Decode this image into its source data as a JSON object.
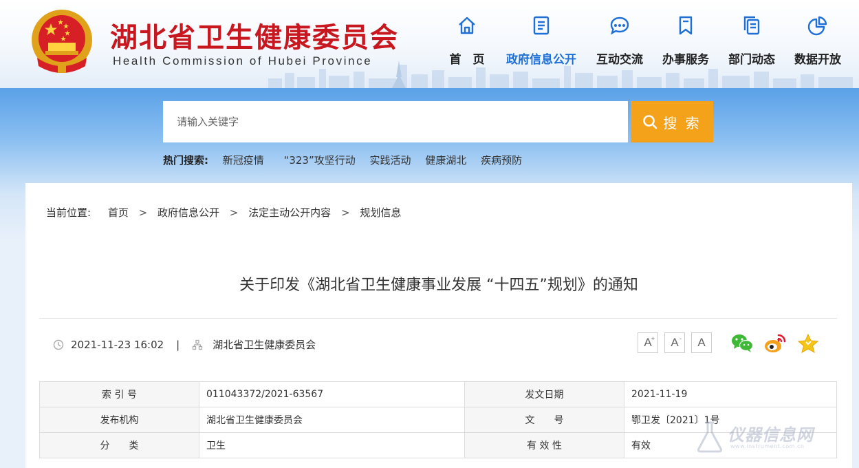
{
  "header": {
    "title": "湖北省卫生健康委员会",
    "subtitle": "Health Commission of Hubei Province",
    "nav": [
      {
        "label": "首　页",
        "icon": "home-icon"
      },
      {
        "label": "政府信息公开",
        "icon": "document-list-icon",
        "active": true
      },
      {
        "label": "互动交流",
        "icon": "chat-bubble-icon"
      },
      {
        "label": "办事服务",
        "icon": "bookmark-icon"
      },
      {
        "label": "部门动态",
        "icon": "copy-document-icon"
      },
      {
        "label": "数据开放",
        "icon": "pie-chart-icon"
      }
    ]
  },
  "search": {
    "placeholder": "请输入关键字",
    "button_label": "搜 索",
    "hot_label": "热门搜索:",
    "hot_terms": [
      "新冠疫情",
      "“323”攻坚行动",
      "实践活动",
      "健康湖北",
      "疾病预防"
    ]
  },
  "breadcrumb": {
    "label": "当前位置:",
    "items": [
      "首页",
      "政府信息公开",
      "法定主动公开内容",
      "规划信息"
    ],
    "separator": ">"
  },
  "article": {
    "title": "关于印发《湖北省卫生健康事业发展 “十四五”规划》的通知",
    "datetime": "2021-11-23 16:02",
    "separator": "|",
    "publisher": "湖北省卫生健康委员会",
    "font_sizes": [
      "A",
      "A",
      "A"
    ],
    "share_icons": [
      "wechat-icon",
      "weibo-icon",
      "favorite-star-icon"
    ]
  },
  "info_table": [
    {
      "k1": "索 引 号",
      "v1": "011043372/2021-63567",
      "k2": "发文日期",
      "v2": "2021-11-19"
    },
    {
      "k1": "发布机构",
      "v1": "湖北省卫生健康委员会",
      "k2": "文　　号",
      "v2": "鄂卫发〔2021〕1号"
    },
    {
      "k1": "分　　类",
      "v1": "卫生",
      "k2": "有 效 性",
      "v2": "有效"
    }
  ],
  "watermark": {
    "text": "仪器信息网",
    "sub": "www.instrument.com.cn"
  },
  "colors": {
    "brand_red": "#c8171e",
    "nav_active": "#1e6fd6",
    "search_button": "#f5a21b"
  }
}
